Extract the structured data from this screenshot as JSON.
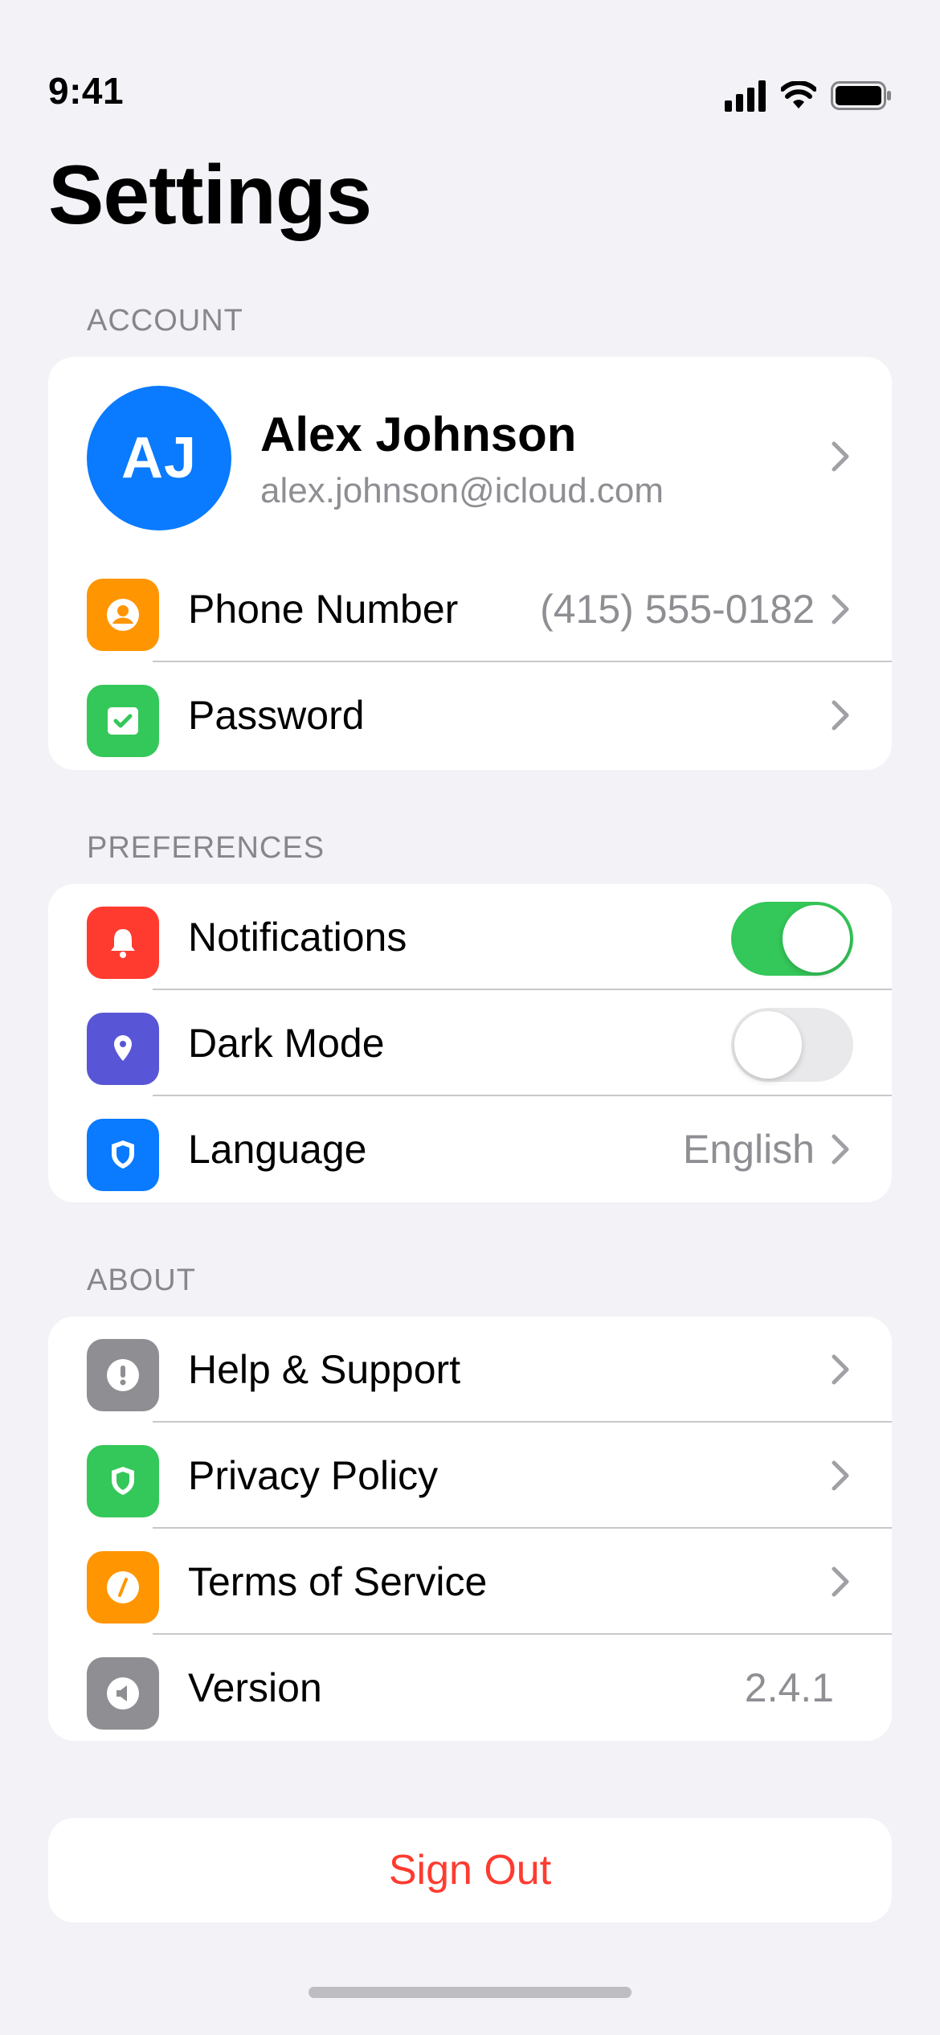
{
  "status_bar": {
    "time": "9:41"
  },
  "page": {
    "title": "Settings"
  },
  "sections": {
    "account": "ACCOUNT",
    "preferences": "PREFERENCES",
    "about": "ABOUT"
  },
  "account": {
    "avatar_initials": "AJ",
    "name": "Alex Johnson",
    "email": "alex.johnson@icloud.com",
    "phone_label": "Phone Number",
    "phone_value": "(415) 555-0182",
    "password_label": "Password"
  },
  "preferences": {
    "notifications_label": "Notifications",
    "notifications_on": true,
    "dark_mode_label": "Dark Mode",
    "dark_mode_on": false,
    "language_label": "Language",
    "language_value": "English"
  },
  "about": {
    "help_label": "Help & Support",
    "privacy_label": "Privacy Policy",
    "terms_label": "Terms of Service",
    "version_label": "Version",
    "version_value": "2.4.1"
  },
  "actions": {
    "sign_out": "Sign Out"
  },
  "colors": {
    "background": "#F2F2F7",
    "accent_blue": "#0A7AFF",
    "orange": "#FF9500",
    "green": "#34C759",
    "red": "#FF3B30",
    "purple": "#5856D6",
    "gray": "#8E8E93"
  },
  "icons": {
    "phone": "person-icon",
    "password": "checkmark-icon",
    "notifications": "bell-icon",
    "dark_mode": "location-pin-icon",
    "language": "shield-icon",
    "help": "exclamation-icon",
    "privacy": "shield-icon",
    "terms": "compass-icon",
    "version": "speaker-icon"
  }
}
